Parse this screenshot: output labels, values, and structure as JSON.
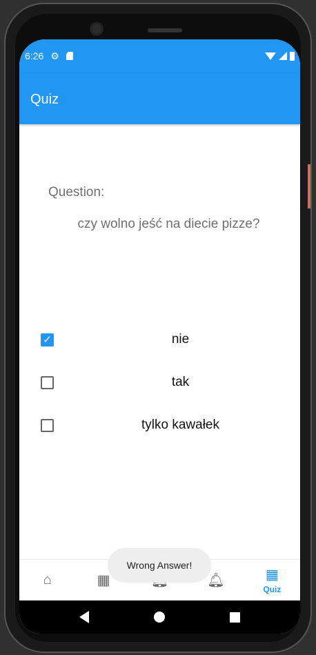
{
  "status_bar": {
    "time": "6:26",
    "icons": [
      "gear-icon",
      "sd-card-icon",
      "wifi-icon",
      "signal-icon",
      "battery-icon"
    ]
  },
  "app_bar": {
    "title": "Quiz"
  },
  "question": {
    "label": "Question:",
    "text": "czy wolno jeść na diecie pizze?"
  },
  "options": [
    {
      "label": "nie",
      "checked": true
    },
    {
      "label": "tak",
      "checked": false
    },
    {
      "label": "tylko kawałek",
      "checked": false
    }
  ],
  "toast": "Wrong Answer!",
  "bottom_nav": [
    {
      "icon": "home-icon",
      "label": ""
    },
    {
      "icon": "dashboard-icon",
      "label": ""
    },
    {
      "icon": "bell-icon",
      "label": ""
    },
    {
      "icon": "bell-icon",
      "label": ""
    },
    {
      "icon": "dashboard-icon",
      "label": "Quiz",
      "active": true
    }
  ],
  "colors": {
    "accent": "#2196f3"
  }
}
